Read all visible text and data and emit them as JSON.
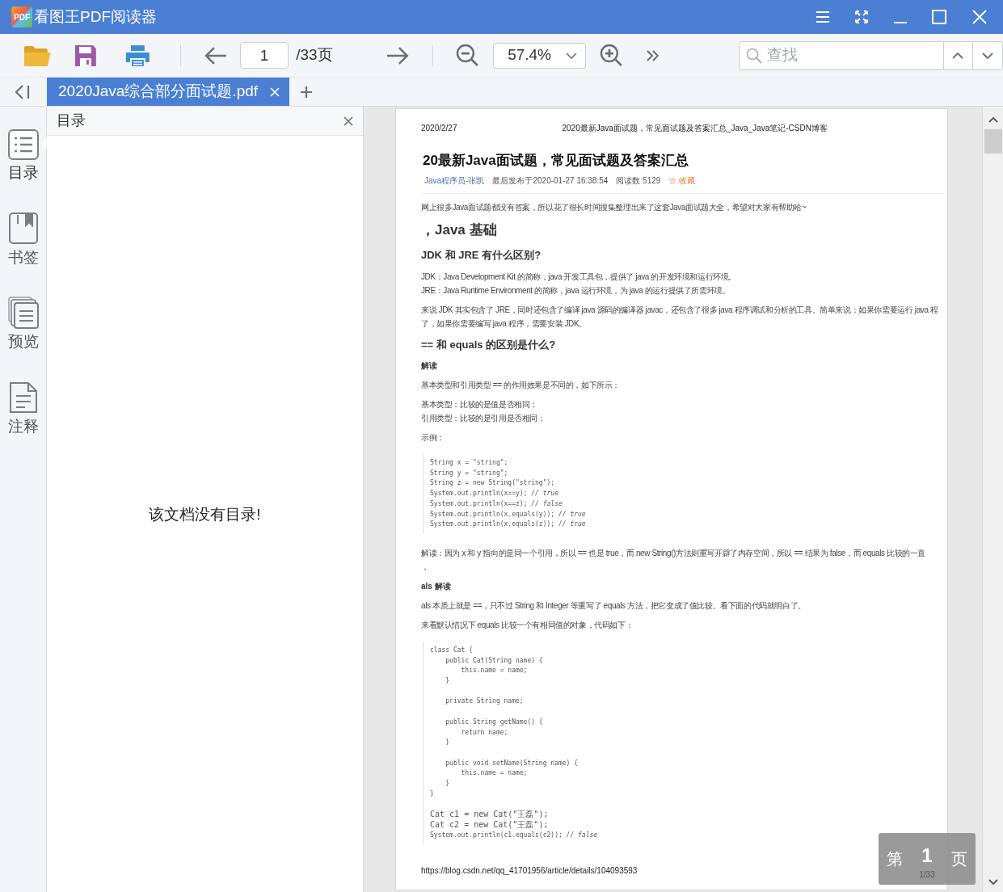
{
  "app": {
    "logo_text": "PDF",
    "title": "看图王PDF阅读器"
  },
  "toolbar": {
    "page_input": "1",
    "page_total": "/33页",
    "zoom": "57.4%",
    "search": {
      "placeholder": "查找"
    }
  },
  "tabs": [
    {
      "label": "2020Java综合部分面试题.pdf",
      "selected": true
    }
  ],
  "sidebar": {
    "items": [
      {
        "kind": "outline",
        "label": "目录",
        "selected": true
      },
      {
        "kind": "bookmark",
        "label": "书签",
        "selected": false
      },
      {
        "kind": "preview",
        "label": "预览",
        "selected": false
      },
      {
        "kind": "annotation",
        "label": "注释",
        "selected": false
      }
    ]
  },
  "outline_panel": {
    "title": "目录",
    "empty_message": "该文档没有目录!"
  },
  "document_page": {
    "header_left": "2020/2/27",
    "header_center": "2020最新Java面试题，常见面试题及答案汇总_Java_Java笔记-CSDN博客",
    "blocks": [
      {
        "kind": "title",
        "text": "20最新Java面试题，常见面试题及答案汇总"
      },
      {
        "kind": "meta",
        "author": "Java程序员-张凯",
        "published": "最后发布于2020-01-27 16:38:54",
        "reads": "阅读数 5129",
        "favorite": "☆ 收藏"
      },
      {
        "kind": "para",
        "text": "网上很多Java面试题都没有答案，所以花了很长时间搜集整理出来了这套Java面试题大全，希望对大家有帮助哈~"
      },
      {
        "kind": "h1",
        "text": "，Java 基础"
      },
      {
        "kind": "h2",
        "text": "JDK 和 JRE 有什么区别?"
      },
      {
        "kind": "para",
        "text": "JDK：Java Development Kit 的简称，java 开发工具包，提供了 java 的开发环境和运行环境。"
      },
      {
        "kind": "para_tight",
        "text": "JRE：Java Runtime Environment 的简称，java 运行环境，为 java 的运行提供了所需环境。"
      },
      {
        "kind": "para",
        "text": "来说 JDK 其实包含了 JRE，同时还包含了编译 java 源码的编译器 javac，还包含了很多 java 程序调试和分析的工具。简单来说：如果你需要运行 java 程"
      },
      {
        "kind": "para_tight",
        "text": "了，如果你需要编写 java 程序，需要安装 JDK。"
      },
      {
        "kind": "h2",
        "text": "== 和 equals 的区别是什么?"
      },
      {
        "kind": "h3",
        "text": "解读"
      },
      {
        "kind": "para",
        "text": "基本类型和引用类型 == 的作用效果是不同的，如下所示："
      },
      {
        "kind": "para",
        "text": "基本类型：比较的是值是否相同；"
      },
      {
        "kind": "para_tight",
        "text": "引用类型：比较的是引用是否相同；"
      },
      {
        "kind": "para",
        "text": "示例："
      },
      {
        "kind": "code",
        "groups": [
          [
            "String x = \"string\";",
            "String y = \"string\";",
            "String z = new String(\"string\");",
            "System.out.println(x==y); *// true*",
            "System.out.println(x==z); *// false*",
            "System.out.println(x.equals(y)); *// true*",
            "System.out.println(x.equals(z)); *// true*"
          ]
        ]
      },
      {
        "kind": "para",
        "text": "解读：因为 x 和 y 指向的是同一个引用，所以 == 也是 true，而 new String()方法则重写开辟了内存空间，所以 == 结果为 false，而 equals 比较的一直"
      },
      {
        "kind": "para_tight",
        "text": "，"
      },
      {
        "kind": "h3",
        "text": "als 解读"
      },
      {
        "kind": "para",
        "text": "als 本质上就是 ==，只不过 String 和 Integer 等重写了 equals 方法，把它变成了值比较。看下面的代码就明白了。"
      },
      {
        "kind": "para",
        "text": "来看默认情况下 equals 比较一个有相同值的对象，代码如下："
      },
      {
        "kind": "code",
        "groups": [
          [
            "class Cat {",
            "    public Cat(String name) {",
            "        this.name = name;",
            "    }"
          ],
          [
            "    private String name;"
          ],
          [
            "    public String getName() {",
            "        return name;",
            "    }"
          ],
          [
            "    public void setName(String name) {",
            "        this.name = name;",
            "    }",
            "}"
          ],
          [
            "Cat c1 = new Cat(\"王磊\");",
            "Cat c2 = new Cat(\"王磊\");",
            "System.out.println(c1.equals(c2)); *// false*"
          ]
        ]
      }
    ],
    "footer_url": "https://blog.csdn.net/qq_41701956/article/details/104093593"
  },
  "page_indicator": {
    "prefix": "第",
    "number": "1",
    "suffix": "页",
    "total": "1/33"
  }
}
